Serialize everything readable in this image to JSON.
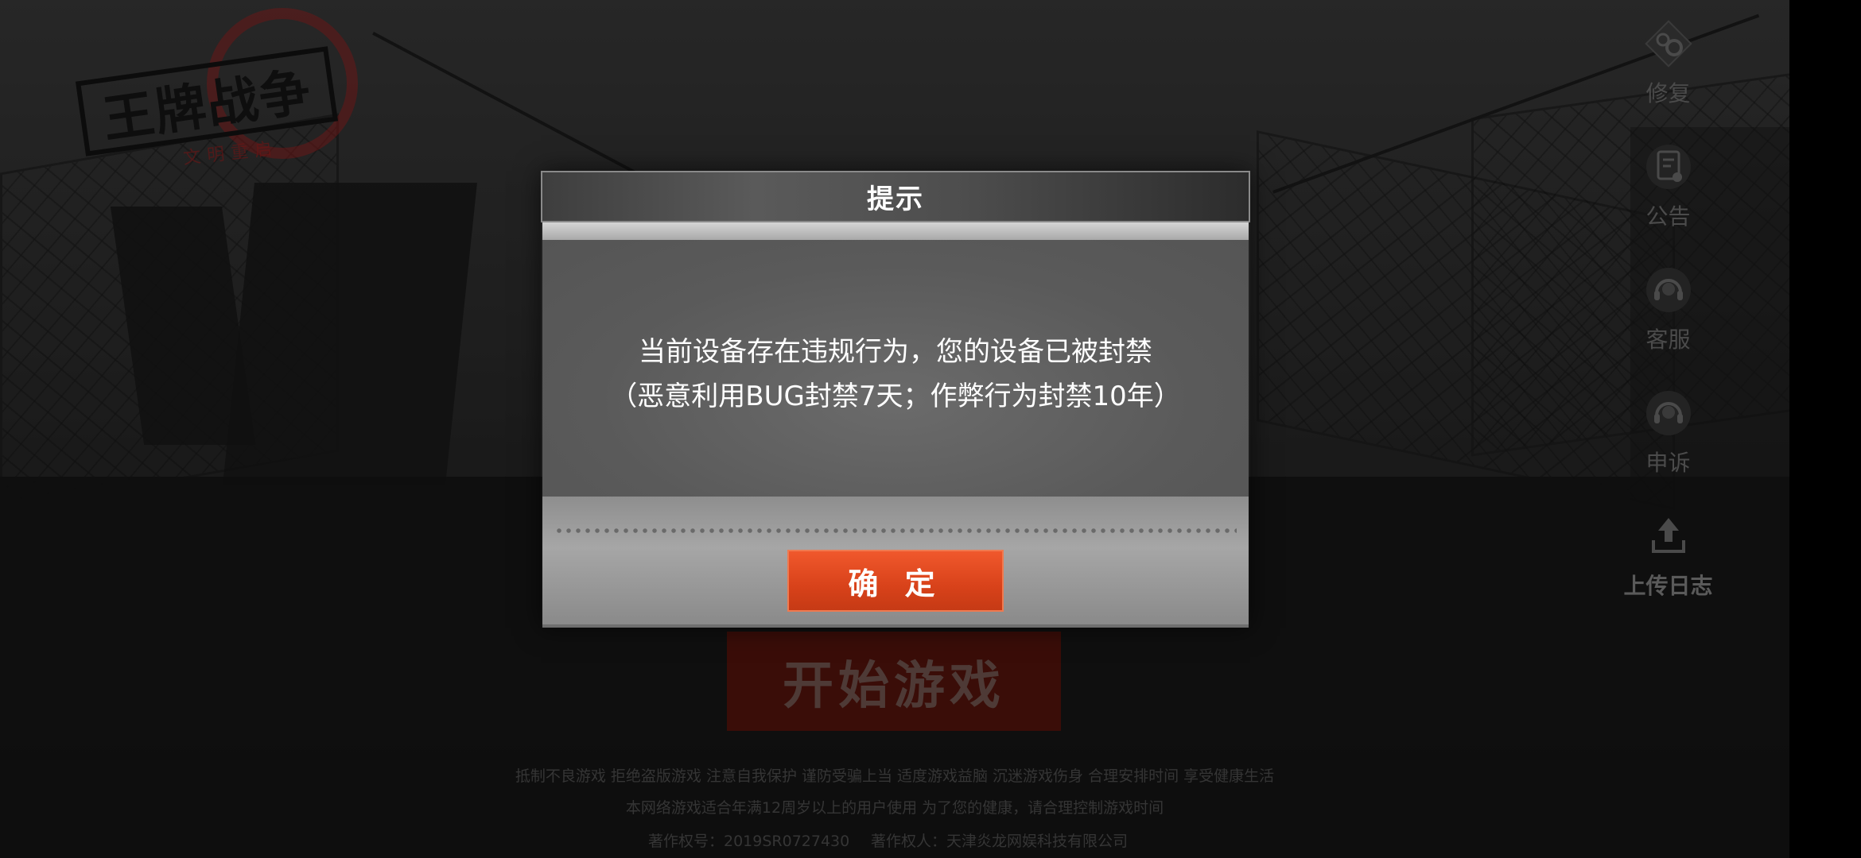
{
  "logo": {
    "title": "王牌战争",
    "subtitle": "文明重启"
  },
  "sidebar": {
    "items": [
      {
        "label": "修复",
        "icon": "gear-icon"
      },
      {
        "label": "公告",
        "icon": "announcement-icon"
      },
      {
        "label": "客服",
        "icon": "headset-icon"
      },
      {
        "label": "申诉",
        "icon": "headset-icon"
      },
      {
        "label": "上传日志",
        "icon": "upload-icon"
      }
    ]
  },
  "start_button": {
    "label": "开始游戏"
  },
  "footer": {
    "line1": "抵制不良游戏 拒绝盗版游戏 注意自我保护 谨防受骗上当 适度游戏益脑 沉迷游戏伤身 合理安排时间 享受健康生活",
    "line2": "本网络游戏适合年满12周岁以上的用户使用   为了您的健康，请合理控制游戏时间",
    "copyright_no": "著作权号：2019SR0727430",
    "copyright_owner": "著作权人：天津炎龙网娱科技有限公司"
  },
  "dialog": {
    "title": "提示",
    "message_line1": "当前设备存在违规行为，您的设备已被封禁",
    "message_line2": "（恶意利用BUG封禁7天；作弊行为封禁10年）",
    "confirm_label": "确 定"
  },
  "colors": {
    "confirm_button": "#e04a20",
    "start_button_dimmed": "#3a0d08",
    "dialog_body": "#5e5e5e"
  }
}
